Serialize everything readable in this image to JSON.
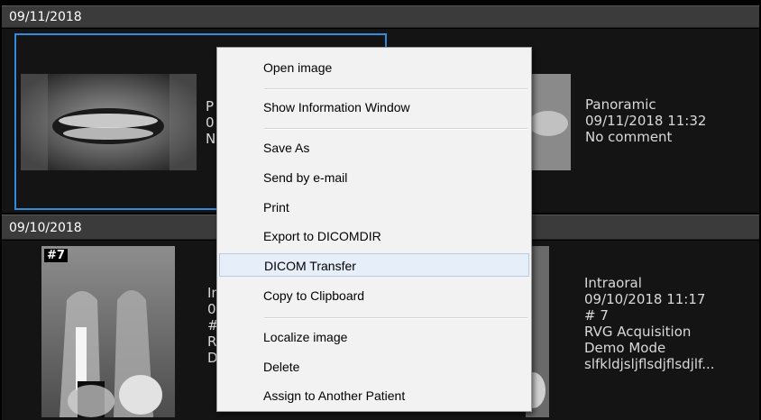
{
  "groups": [
    {
      "date": "09/11/2018",
      "cards": [
        {
          "lines": [
            "P",
            "0",
            "N"
          ],
          "badge": ""
        },
        {
          "lines": [
            "Panoramic",
            "09/11/2018 11:32",
            "No comment"
          ],
          "badge": ""
        }
      ]
    },
    {
      "date": "09/10/2018",
      "cards": [
        {
          "lines": [
            "In",
            "0",
            "#",
            "R",
            "D"
          ],
          "badge": "#7"
        },
        {
          "lines": [
            "Intraoral",
            "09/10/2018 11:17",
            "# 7",
            "RVG Acquisition",
            "Demo Mode",
            "slfkldjsljflsdjflsdjlf..."
          ],
          "badge": ""
        }
      ]
    }
  ],
  "context_menu": {
    "items": [
      "Open image",
      "Show Information Window",
      "Save As",
      "Send by e-mail",
      "Print",
      "Export to DICOMDIR",
      "DICOM Transfer",
      "Copy to Clipboard",
      "Localize image",
      "Delete",
      "Assign to Another Patient"
    ],
    "highlighted_index": 6
  },
  "colors": {
    "selection": "#2f8be0",
    "menu_hover": "#e6eef9"
  }
}
